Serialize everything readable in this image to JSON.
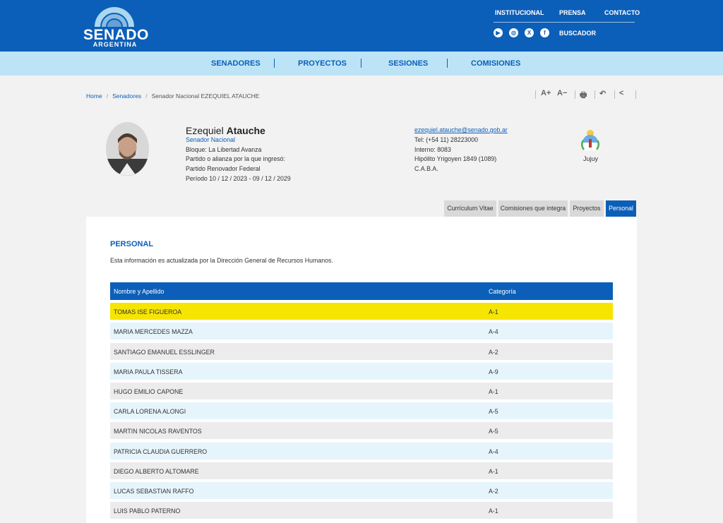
{
  "header": {
    "logo": {
      "title": "SENADO",
      "subtitle": "ARGENTINA"
    },
    "top_links": [
      "INSTITUCIONAL",
      "PRENSA",
      "CONTACTO"
    ],
    "socials": [
      {
        "name": "youtube-icon",
        "glyph": "▶"
      },
      {
        "name": "instagram-icon",
        "glyph": "◎"
      },
      {
        "name": "x-icon",
        "glyph": "X"
      },
      {
        "name": "facebook-icon",
        "glyph": "f"
      }
    ],
    "buscador": "BUSCADOR",
    "brand_color": "#0c5fb8"
  },
  "nav": {
    "items": [
      "SENADORES",
      "PROYECTOS",
      "SESIONES",
      "COMISIONES"
    ]
  },
  "breadcrumb": {
    "home": "Home",
    "senadores": "Senadores",
    "current": "Senador Nacional EZEQUIEL ATAUCHE"
  },
  "tools": {
    "increase": "A+",
    "decrease": "A−",
    "print": "🖶",
    "back": "↶",
    "share": "<"
  },
  "senator": {
    "first_name": "Ezequiel",
    "last_name": "Atauche",
    "role": "Senador Nacional",
    "bloque": "Bloque: La Libertad Avanza",
    "partido_label": "Partido o alianza por la que ingresó:",
    "partido": "Partido Renovador Federal",
    "periodo": "Período 10 / 12 / 2023 - 09 / 12 / 2029",
    "email": "ezequiel.atauche@senado.gob.ar",
    "tel": "Tel: (+54 11) 28223000",
    "interno": "Interno: 8083",
    "direccion": "Hipólito Yrigoyen 1849 (1089)",
    "ciudad": "C.A.B.A.",
    "provincia": "Jujuy"
  },
  "tabs": [
    "Currículum Vitae",
    "Comisiones que integra",
    "Proyectos",
    "Personal"
  ],
  "active_tab": "Personal",
  "personal": {
    "title": "PERSONAL",
    "description": "Esta información es actualizada por la Dirección General de Recursos Humanos.",
    "columns": [
      "Nombre y Apellido",
      "Categoría"
    ],
    "rows": [
      {
        "nombre": "TOMAS ISE FIGUEROA",
        "categoria": "A-1"
      },
      {
        "nombre": "MARIA MERCEDES MAZZA",
        "categoria": "A-4"
      },
      {
        "nombre": "SANTIAGO EMANUEL ESSLINGER",
        "categoria": "A-2"
      },
      {
        "nombre": "MARIA PAULA TISSERA",
        "categoria": "A-9"
      },
      {
        "nombre": "HUGO EMILIO CAPONE",
        "categoria": "A-1"
      },
      {
        "nombre": "CARLA LORENA ALONGI",
        "categoria": "A-5"
      },
      {
        "nombre": "MARTIN NICOLAS RAVENTOS",
        "categoria": "A-5"
      },
      {
        "nombre": "PATRICIA CLAUDIA GUERRERO",
        "categoria": "A-4"
      },
      {
        "nombre": "DIEGO ALBERTO ALTOMARE",
        "categoria": "A-1"
      },
      {
        "nombre": "LUCAS SEBASTIAN RAFFO",
        "categoria": "A-2"
      },
      {
        "nombre": "LUIS PABLO PATERNO",
        "categoria": "A-1"
      }
    ],
    "highlight_color": "#f6e500"
  }
}
